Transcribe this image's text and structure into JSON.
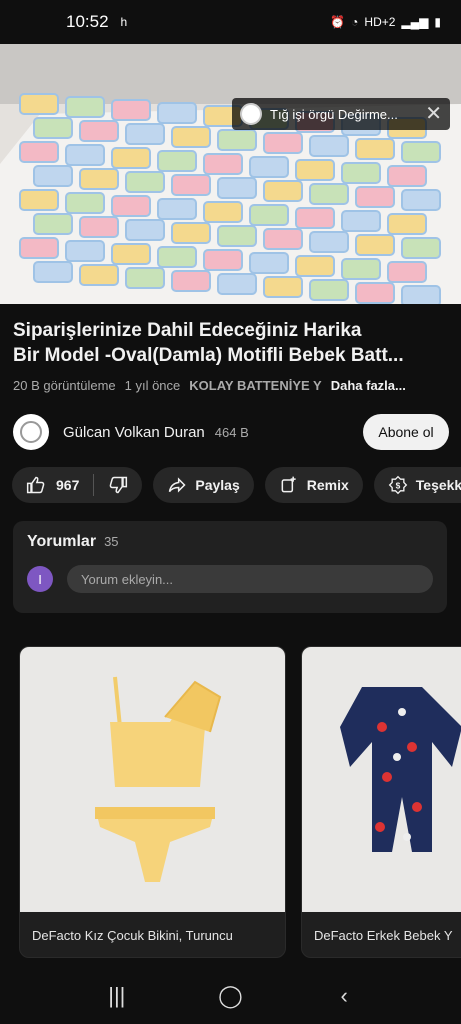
{
  "status": {
    "time": "10:52",
    "notif": "h",
    "indicators": "HD+2"
  },
  "video": {
    "chip_title": "Tığ işi örgü Değirme...",
    "close_label": "✕"
  },
  "title": {
    "line1": "Siparişlerinize Dahil Edeceğiniz Harika",
    "line2": "Bir Model -Oval(Damla) Motifli Bebek Batt..."
  },
  "meta": {
    "views": "20 B görüntüleme",
    "age": "1 yıl önce",
    "tag": "KOLAY BATTENİYE Y",
    "more": "Daha fazla..."
  },
  "channel": {
    "name": "Gülcan Volkan Duran",
    "subs": "464 B",
    "subscribe_label": "Abone ol"
  },
  "actions": {
    "likes": "967",
    "share": "Paylaş",
    "remix": "Remix",
    "thanks": "Teşekkür"
  },
  "comments": {
    "title": "Yorumlar",
    "count": "35",
    "avatar_letter": "I",
    "placeholder": "Yorum ekleyin..."
  },
  "products": [
    {
      "caption": "DeFacto Kız Çocuk Bikini, Turuncu"
    },
    {
      "caption": "DeFacto Erkek Bebek Y"
    }
  ],
  "colors": {
    "background": "#0f0f0f",
    "pill": "#272727",
    "card": "#212121",
    "comment_avatar": "#7e57c2"
  }
}
